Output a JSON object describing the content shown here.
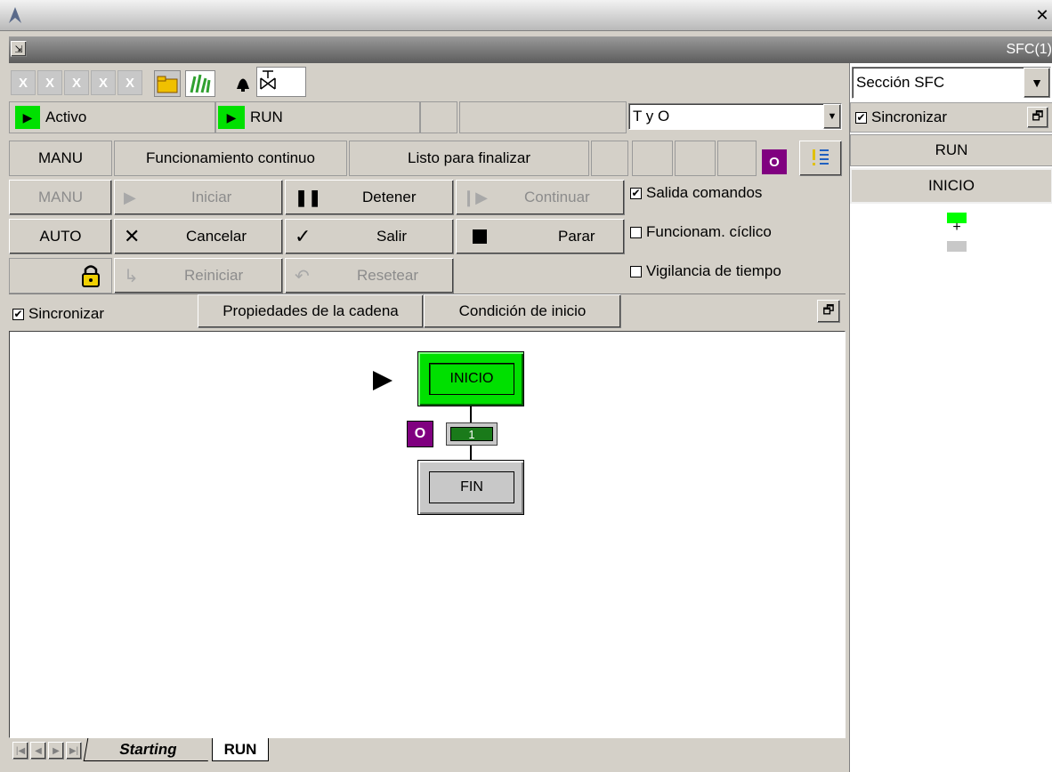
{
  "window": {
    "panel_title": "SFC(1)"
  },
  "right": {
    "section_select": "Sección SFC",
    "sync_label": "Sincronizar",
    "run_label": "RUN",
    "inicio_label": "INICIO"
  },
  "status": {
    "activo": "Activo",
    "run": "RUN",
    "combo_value": "T y O"
  },
  "modes": {
    "manu_top": "MANU",
    "continuous": "Funcionamiento continuo",
    "ready": "Listo para finalizar",
    "o_badge": "O"
  },
  "controls": {
    "manu": "MANU",
    "auto": "AUTO",
    "iniciar": "Iniciar",
    "detener": "Detener",
    "continuar": "Continuar",
    "cancelar": "Cancelar",
    "salir": "Salir",
    "parar": "Parar",
    "reiniciar": "Reiniciar",
    "resetear": "Resetear"
  },
  "options": {
    "salida": "Salida comandos",
    "ciclico": "Funcionam. cíclico",
    "vigilancia": "Vigilancia de tiempo"
  },
  "tabsbar": {
    "sync_label": "Sincronizar",
    "propiedades": "Propiedades de la cadena",
    "condicion": "Condición de inicio"
  },
  "diagram": {
    "step_inicio": "INICIO",
    "transition_o": "O",
    "transition_num": "1",
    "step_fin": "FIN"
  },
  "sheets": {
    "tabs": [
      "Starting",
      "RUN"
    ]
  },
  "colors": {
    "active_green": "#00e000",
    "transition_green": "#1a7a1a",
    "purple": "#800080"
  }
}
